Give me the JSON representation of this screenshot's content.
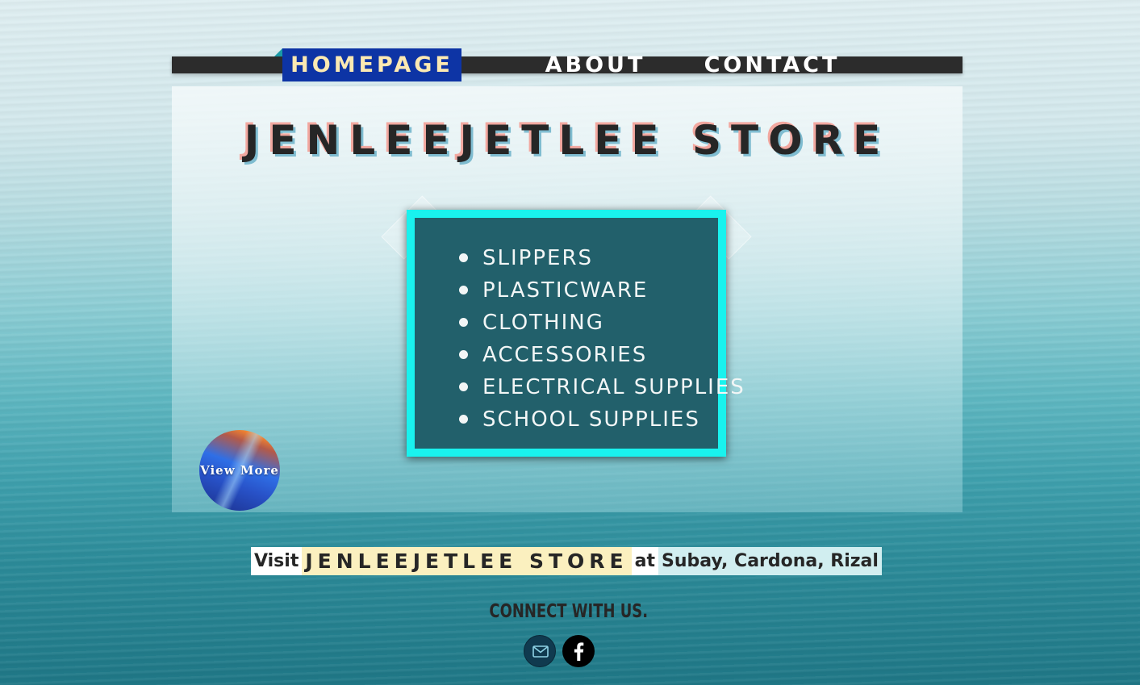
{
  "nav": {
    "items": [
      {
        "label": "HOMEPAGE",
        "active": true
      },
      {
        "label": "ABOUT",
        "active": false
      },
      {
        "label": "CONTACT",
        "active": false
      }
    ]
  },
  "store": {
    "title": "JENLEEJETLEE STORE"
  },
  "products": {
    "items": [
      "SLIPPERS",
      "PLASTICWARE",
      "CLOTHING",
      "ACCESSORIES",
      "ELECTRICAL SUPPLIES",
      "SCHOOL SUPPLIES"
    ]
  },
  "view_more": {
    "label": "View More"
  },
  "visit": {
    "prefix": "Visit",
    "store": "JENLEEJETLEE STORE",
    "at": "at",
    "place": "Subay, Cardona, Rizal"
  },
  "connect": {
    "heading": "CONNECT WITH US.",
    "icons": [
      "mail-icon",
      "facebook-icon"
    ]
  },
  "colors": {
    "nav_active_bg": "#0d34a5",
    "nav_active_text": "#fbe9b2",
    "product_box_bg": "#22606b",
    "product_box_border": "#19f2ee"
  }
}
